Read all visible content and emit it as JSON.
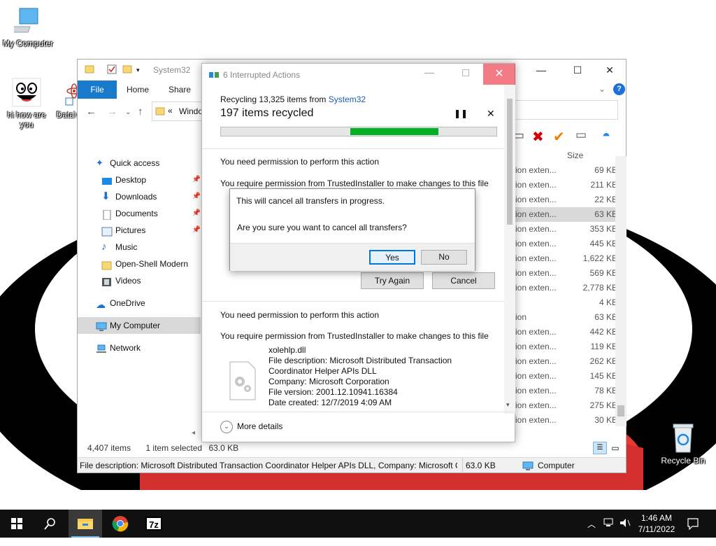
{
  "desktop": {
    "icons": [
      {
        "label": "My Computer"
      },
      {
        "label": "hi how are you"
      },
      {
        "label": "DataV"
      },
      {
        "label": "Recycle Bin"
      }
    ]
  },
  "explorer": {
    "title": "System32",
    "ribbon_tabs": [
      "File",
      "Home",
      "Share"
    ],
    "address_partial": "Windo",
    "nav_pane": [
      {
        "label": "Quick access",
        "icon": "star-icon"
      },
      {
        "label": "Desktop",
        "icon": "desktop-folder-icon",
        "pinned": true
      },
      {
        "label": "Downloads",
        "icon": "downloads-icon",
        "pinned": true
      },
      {
        "label": "Documents",
        "icon": "documents-icon",
        "pinned": true
      },
      {
        "label": "Pictures",
        "icon": "pictures-icon",
        "pinned": true
      },
      {
        "label": "Music",
        "icon": "music-icon"
      },
      {
        "label": "Open-Shell Modern",
        "icon": "folder-icon"
      },
      {
        "label": "Videos",
        "icon": "videos-icon"
      },
      {
        "label": "OneDrive",
        "icon": "cloud-icon"
      },
      {
        "label": "My Computer",
        "icon": "computer-icon",
        "selected": true
      },
      {
        "label": "Network",
        "icon": "network-icon"
      }
    ],
    "column_size": "Size",
    "rows": [
      {
        "type": "ion exten...",
        "size": "69 KB"
      },
      {
        "type": "ion exten...",
        "size": "211 KB"
      },
      {
        "type": "ion exten...",
        "size": "22 KB"
      },
      {
        "type": "ion exten...",
        "size": "63 KB",
        "selected": true
      },
      {
        "type": "ion exten...",
        "size": "353 KB"
      },
      {
        "type": "ion exten...",
        "size": "445 KB"
      },
      {
        "type": "ion exten...",
        "size": "1,622 KB"
      },
      {
        "type": "ion exten...",
        "size": "569 KB"
      },
      {
        "type": "ion exten...",
        "size": "2,778 KB"
      },
      {
        "type": "",
        "size": "4 KB"
      },
      {
        "type": "ion",
        "size": "63 KB"
      },
      {
        "type": "ion exten...",
        "size": "442 KB"
      },
      {
        "type": "ion exten...",
        "size": "119 KB"
      },
      {
        "type": "ion exten...",
        "size": "262 KB"
      },
      {
        "type": "ion exten...",
        "size": "145 KB"
      },
      {
        "type": "ion exten...",
        "size": "78 KB"
      },
      {
        "type": "ion exten...",
        "size": "275 KB"
      },
      {
        "type": "ion exten...",
        "size": "30 KB"
      }
    ],
    "status_items": "4,407 items",
    "status_selected": "1 item selected",
    "status_size": "63.0 KB",
    "statusbar_desc": "File description: Microsoft Distributed Transaction Coordinator Helper APIs DLL, Company: Microsoft C",
    "statusbar_size": "63.0 KB",
    "statusbar_location": "Computer"
  },
  "ops_dialog": {
    "title": "6 Interrupted Actions",
    "recycling_prefix": "Recycling 13,325 items from ",
    "recycling_source": "System32",
    "progress_text": "197 items recycled",
    "progress_fraction": 0.32,
    "permission_title": "You need permission to perform this action",
    "permission_sub": "You require permission from TrustedInstaller to make changes to this file",
    "try_again": "Try Again",
    "cancel": "Cancel",
    "file": {
      "name": "xolehlp.dll",
      "description": "File description: Microsoft Distributed Transaction",
      "description_cont": "Coordinator Helper APIs DLL",
      "company": "Company: Microsoft Corporation",
      "version": "File version: 2001.12.10941.16384",
      "created": "Date created: 12/7/2019 4:09 AM"
    },
    "more_details": "More details"
  },
  "confirm_dialog": {
    "line1": "This will cancel all transfers in progress.",
    "line2": "Are you sure you want to cancel all transfers?",
    "yes": "Yes",
    "no": "No"
  },
  "taskbar": {
    "time": "1:46 AM",
    "date": "7/11/2022",
    "sevenzip_label": "7z"
  },
  "colors": {
    "accent": "#1979ca",
    "progress": "#06b025",
    "close_red": "#e81123"
  }
}
